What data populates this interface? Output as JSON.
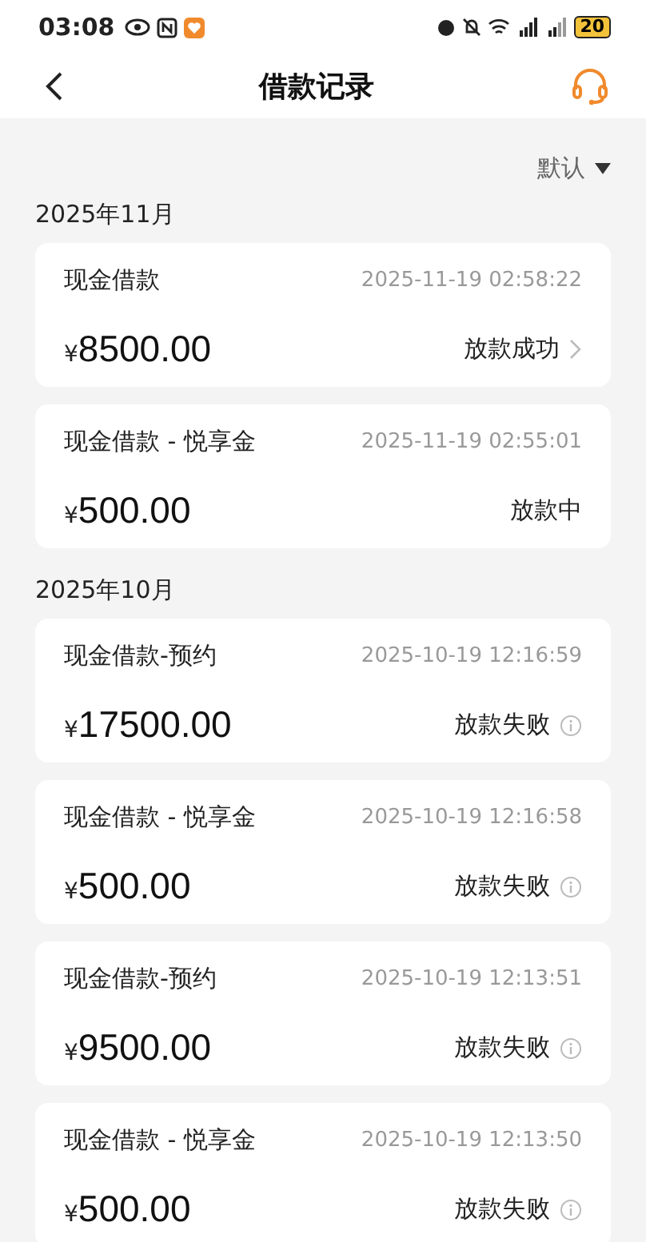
{
  "status_bar": {
    "time": "03:08",
    "battery": "20"
  },
  "header": {
    "title": "借款记录"
  },
  "sort": {
    "label": "默认"
  },
  "groups": [
    {
      "month": "2025年11月",
      "records": [
        {
          "name": "现金借款",
          "time": "2025-11-19 02:58:22",
          "amount": "8500.00",
          "currency": "¥",
          "status": "放款成功",
          "kind": "success"
        },
        {
          "name": "现金借款 - 悦享金",
          "time": "2025-11-19 02:55:01",
          "amount": "500.00",
          "currency": "¥",
          "status": "放款中",
          "kind": "pending"
        }
      ]
    },
    {
      "month": "2025年10月",
      "records": [
        {
          "name": "现金借款-预约",
          "time": "2025-10-19 12:16:59",
          "amount": "17500.00",
          "currency": "¥",
          "status": "放款失败",
          "kind": "failed"
        },
        {
          "name": "现金借款 - 悦享金",
          "time": "2025-10-19 12:16:58",
          "amount": "500.00",
          "currency": "¥",
          "status": "放款失败",
          "kind": "failed"
        },
        {
          "name": "现金借款-预约",
          "time": "2025-10-19 12:13:51",
          "amount": "9500.00",
          "currency": "¥",
          "status": "放款失败",
          "kind": "failed"
        },
        {
          "name": "现金借款 - 悦享金",
          "time": "2025-10-19 12:13:50",
          "amount": "500.00",
          "currency": "¥",
          "status": "放款失败",
          "kind": "failed"
        }
      ]
    }
  ]
}
